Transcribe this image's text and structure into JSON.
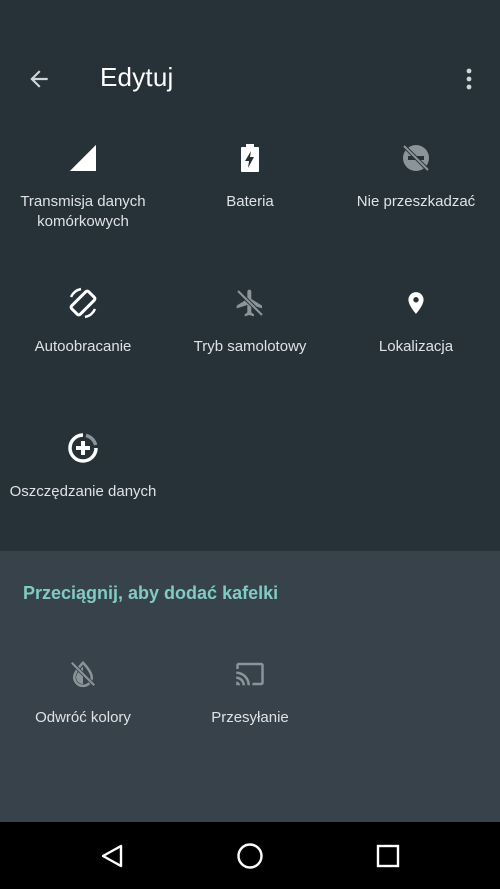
{
  "appbar": {
    "title": "Edytuj",
    "back_icon": "arrow-left-icon",
    "menu_icon": "more-vert-icon"
  },
  "active_tiles": [
    {
      "icon": "cell-signal-icon",
      "label": "Transmisja danych komórkowych"
    },
    {
      "icon": "battery-icon",
      "label": "Bateria"
    },
    {
      "icon": "do-not-disturb-icon",
      "label": "Nie przeszkadzać"
    },
    {
      "icon": "auto-rotate-icon",
      "label": "Autoobracanie"
    },
    {
      "icon": "airplane-icon",
      "label": "Tryb samolotowy"
    },
    {
      "icon": "location-icon",
      "label": "Lokalizacja"
    },
    {
      "icon": "data-saver-icon",
      "label": "Oszczędzanie danych"
    }
  ],
  "add_panel": {
    "title": "Przeciągnij, aby dodać kafelki",
    "tiles": [
      {
        "icon": "invert-colors-icon",
        "label": "Odwróć kolory"
      },
      {
        "icon": "cast-icon",
        "label": "Przesyłanie"
      }
    ]
  },
  "navbar": {
    "back": "nav-back-icon",
    "home": "nav-home-icon",
    "recents": "nav-recents-icon"
  },
  "colors": {
    "background": "#263238",
    "panel": "#37424a",
    "accent": "#80cbc4",
    "icon_active": "#ffffff",
    "icon_dim": "#8a9499"
  }
}
